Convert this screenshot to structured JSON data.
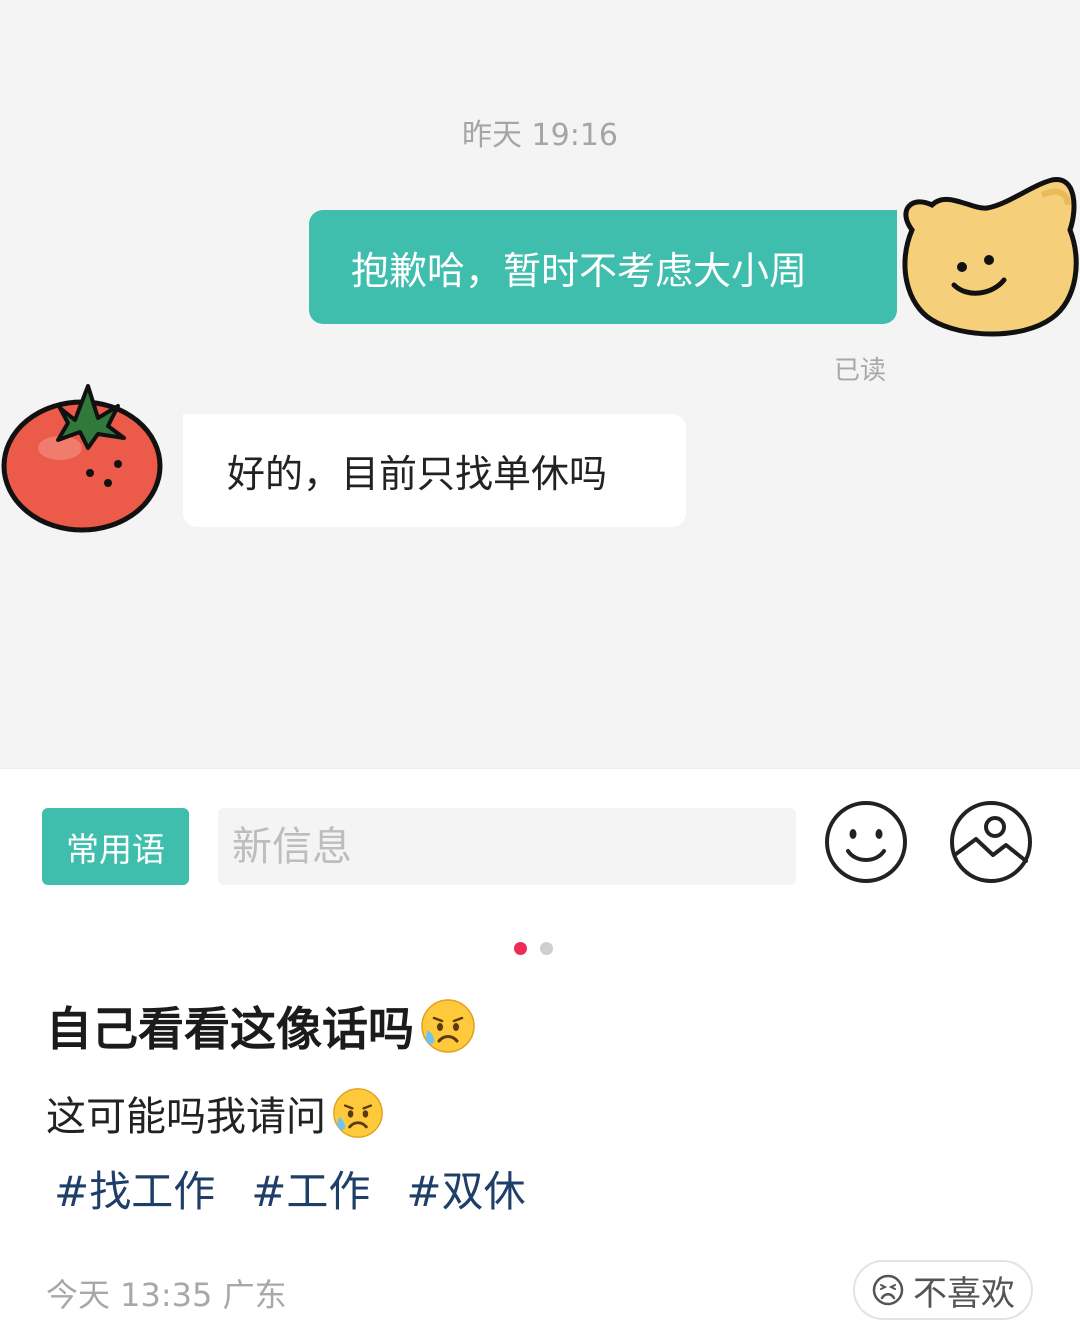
{
  "chat": {
    "timestamp": "昨天 19:16",
    "messages": [
      {
        "direction": "outgoing",
        "text": "抱歉哈，暂时不考虑大小周",
        "avatar": "bear-face-icon"
      },
      {
        "direction": "incoming",
        "text": "好的，目前只找单休吗",
        "avatar": "tomato-icon"
      }
    ],
    "read_status": "已读"
  },
  "input_bar": {
    "phrases_label": "常用语",
    "placeholder": "新信息",
    "emoji_icon": "smiley-icon",
    "image_icon": "image-icon"
  },
  "pager": {
    "current": 1,
    "total": 2
  },
  "post": {
    "title": "自己看看这像话吗",
    "body": "这可能吗我请问",
    "tags": [
      "#找工作",
      "#工作",
      "#双休"
    ],
    "meta": "今天 13:35 广东",
    "dislike_label": "不喜欢"
  },
  "colors": {
    "accent_teal": "#3fbdad",
    "chat_bg": "#f4f4f5",
    "tag_color": "#1f3f69",
    "pager_active": "#ef2c55"
  }
}
